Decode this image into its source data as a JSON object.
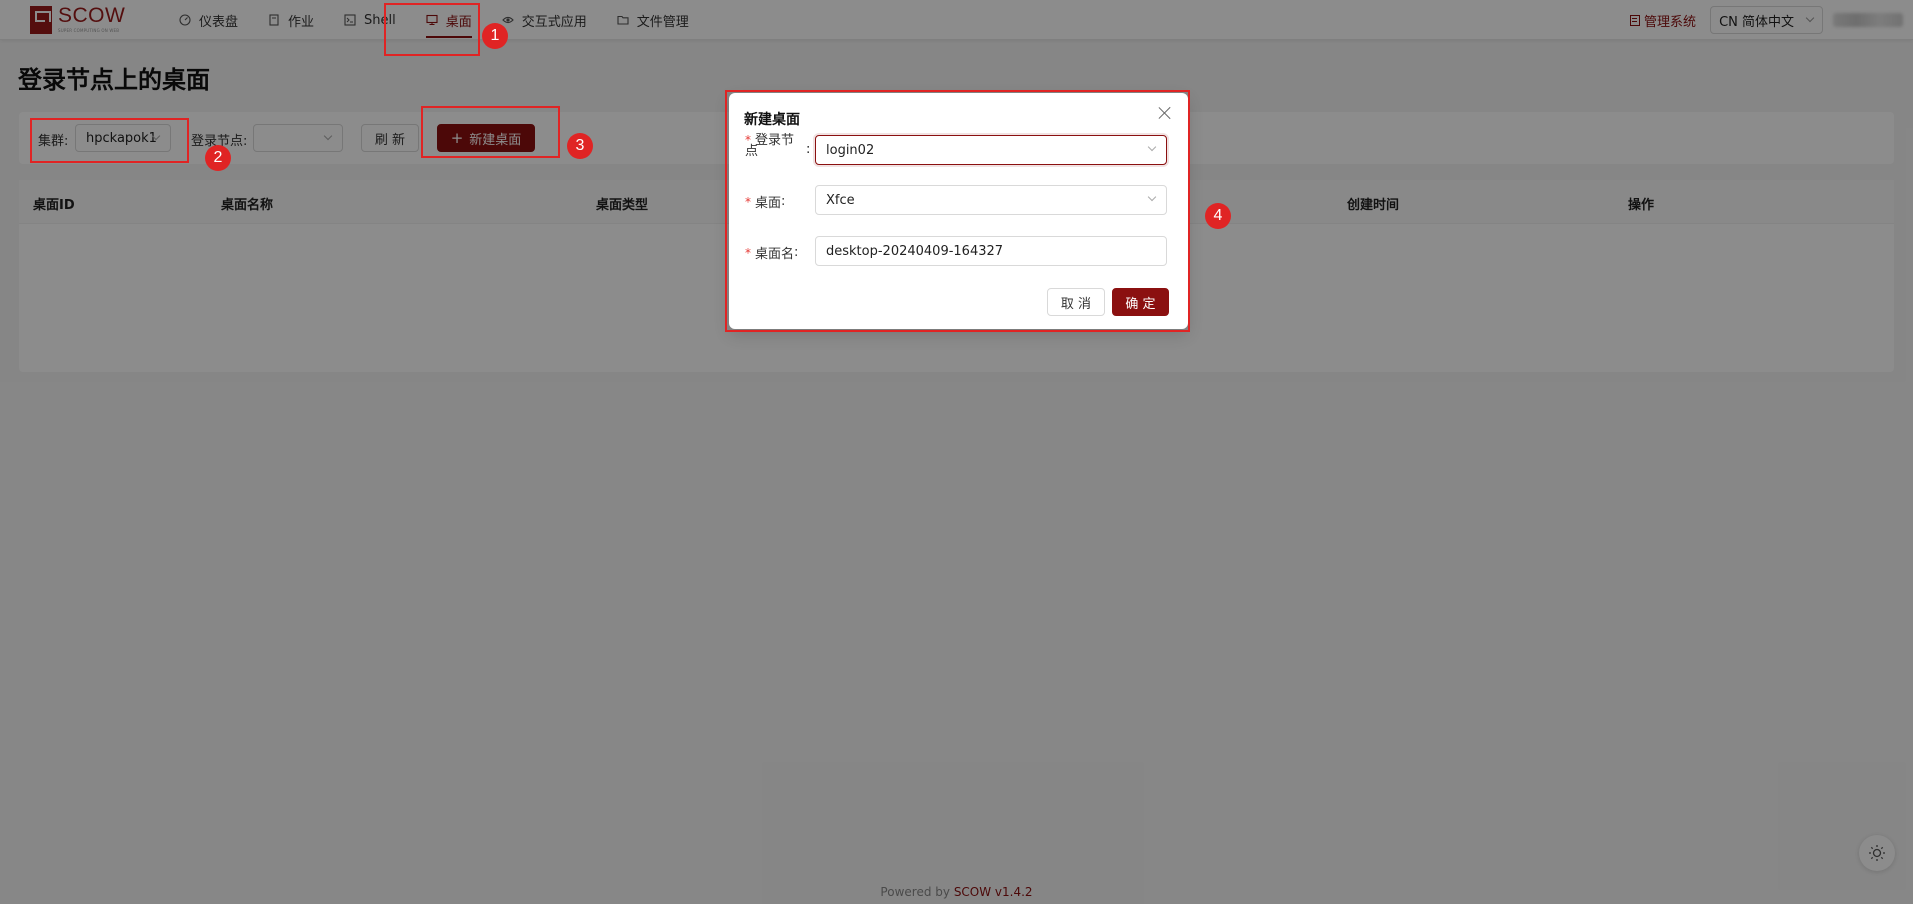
{
  "brand": {
    "name": "SCOW",
    "tagline": "SUPER COMPUTING ON WEB"
  },
  "nav": {
    "items": [
      {
        "label": "仪表盘",
        "icon": "dashboard-icon"
      },
      {
        "label": "作业",
        "icon": "file-icon"
      },
      {
        "label": "Shell",
        "icon": "terminal-icon"
      },
      {
        "label": "桌面",
        "icon": "desktop-icon",
        "active": true
      },
      {
        "label": "交互式应用",
        "icon": "eye-icon"
      },
      {
        "label": "文件管理",
        "icon": "folder-icon"
      }
    ]
  },
  "header": {
    "admin_label": "管理系统",
    "language": "CN 简体中文"
  },
  "page": {
    "title": "登录节点上的桌面"
  },
  "filter": {
    "cluster_label": "集群:",
    "cluster_value": "hpckapok1",
    "login_node_label": "登录节点:",
    "login_node_value": "",
    "refresh_label": "刷 新",
    "new_desktop_label": "新建桌面"
  },
  "table": {
    "columns": [
      "桌面ID",
      "桌面名称",
      "桌面类型",
      "创建时间",
      "操作"
    ]
  },
  "modal": {
    "title": "新建桌面",
    "login_node_label": "登录节点",
    "login_node_value": "login02",
    "desktop_label": "桌面",
    "desktop_value": "Xfce",
    "desktop_name_label": "桌面名",
    "desktop_name_value": "desktop-20240409-164327",
    "cancel_label": "取 消",
    "ok_label": "确 定"
  },
  "footer": {
    "powered_by": "Powered by",
    "version": "SCOW v1.4.2"
  },
  "annotations": [
    "1",
    "2",
    "3",
    "4"
  ],
  "colors": {
    "accent": "#8b1010",
    "annotation": "#e02424"
  }
}
